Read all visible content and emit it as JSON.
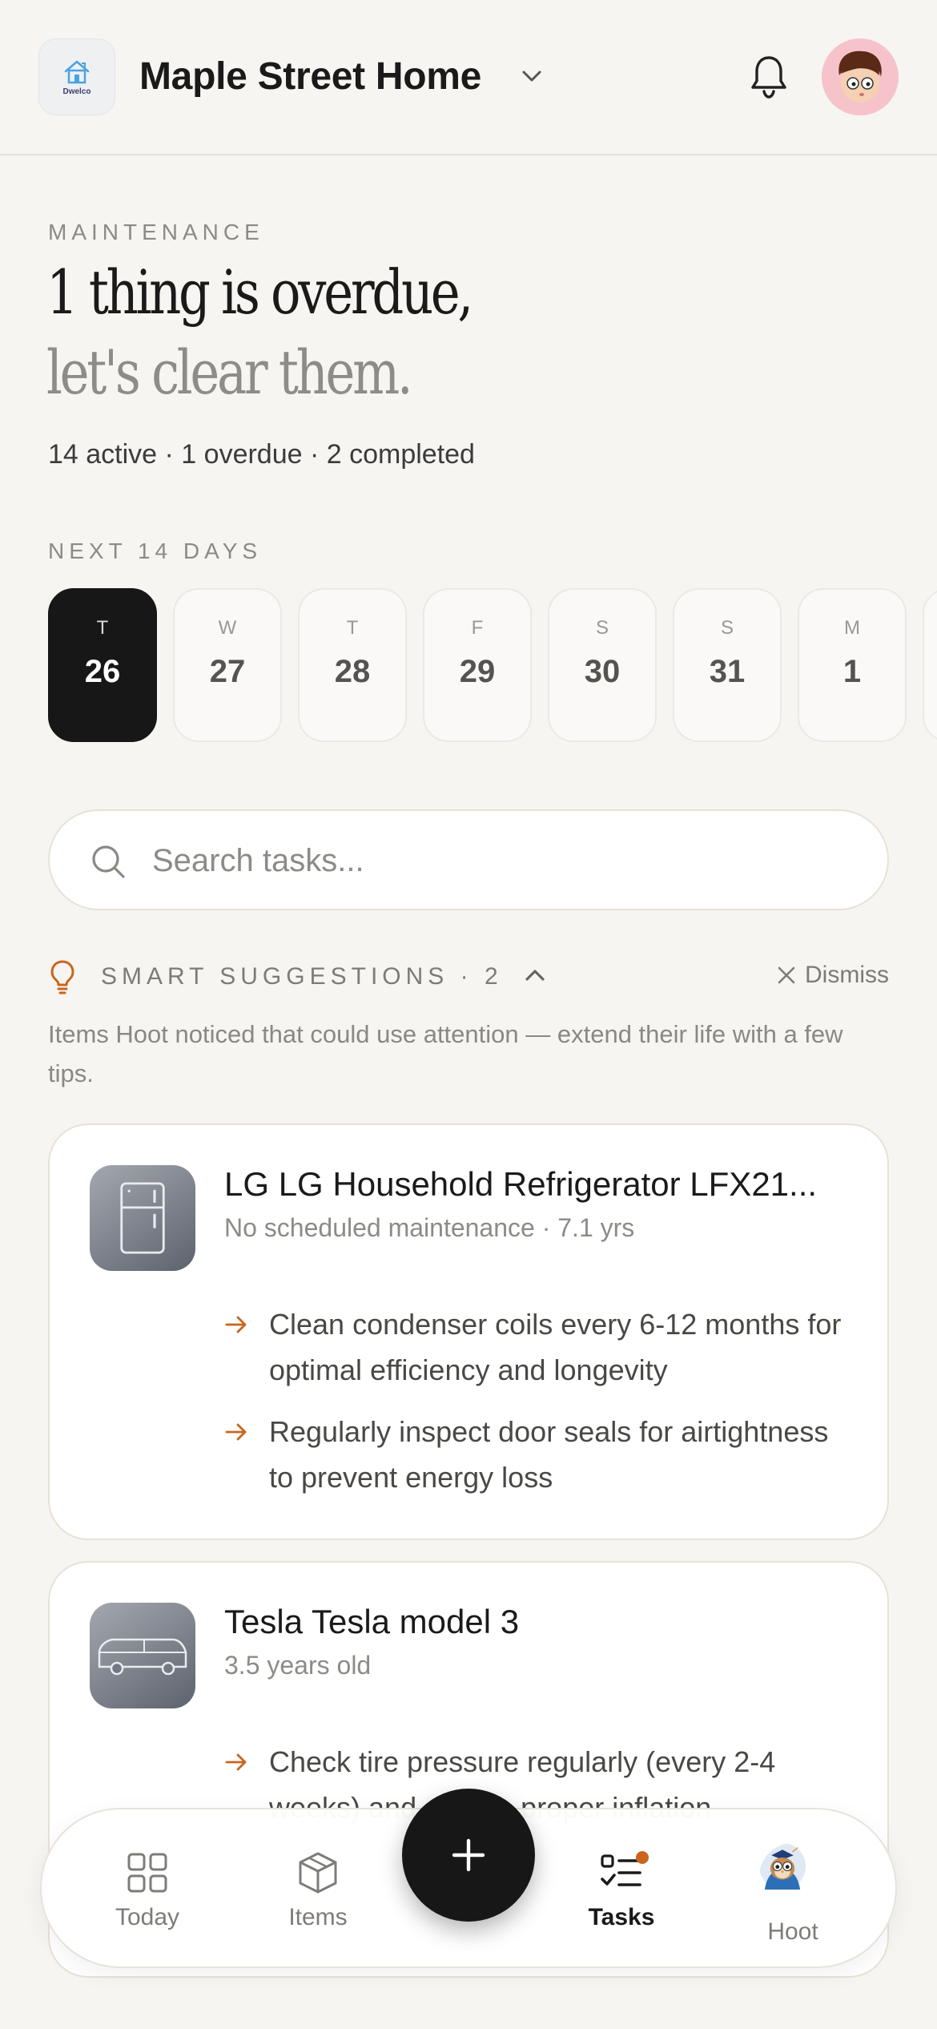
{
  "header": {
    "logo_text": "Dwelco",
    "home_name": "Maple Street Home"
  },
  "hero": {
    "eyebrow": "MAINTENANCE",
    "line1": "1 thing is overdue,",
    "line2": "let's clear them.",
    "stats": "14 active · 1 overdue · 2 completed"
  },
  "calendar": {
    "label": "NEXT 14 DAYS",
    "days": [
      {
        "dow": "T",
        "num": "26",
        "selected": true
      },
      {
        "dow": "W",
        "num": "27"
      },
      {
        "dow": "T",
        "num": "28"
      },
      {
        "dow": "F",
        "num": "29"
      },
      {
        "dow": "S",
        "num": "30"
      },
      {
        "dow": "S",
        "num": "31"
      },
      {
        "dow": "M",
        "num": "1"
      },
      {
        "dow": "",
        "num": ""
      }
    ]
  },
  "search": {
    "placeholder": "Search tasks..."
  },
  "suggestions": {
    "title": "SMART SUGGESTIONS · 2",
    "dismiss_label": "Dismiss",
    "description": "Items Hoot noticed that could use attention — extend their life with a few tips.",
    "cards": [
      {
        "icon": "refrigerator-icon",
        "title": "LG LG Household Refrigerator LFX21...",
        "subtitle": "No scheduled maintenance · 7.1 yrs",
        "tips": [
          "Clean condenser coils every 6-12 months for optimal efficiency and longevity",
          "Regularly inspect door seals for airtightness to prevent energy loss"
        ]
      },
      {
        "icon": "car-icon",
        "title": "Tesla Tesla model 3",
        "subtitle": "3.5 years old",
        "tips": [
          "Check tire pressure regularly (every 2-4 weeks) and ensure proper inflation"
        ]
      }
    ]
  },
  "nav": {
    "items": [
      {
        "label": "Today",
        "icon": "grid-icon"
      },
      {
        "label": "Items",
        "icon": "box-icon"
      },
      {
        "label": "Tasks",
        "icon": "checklist-icon",
        "active": true,
        "badge": true
      },
      {
        "label": "Hoot",
        "icon": "owl-avatar"
      }
    ],
    "fab_icon": "plus-icon"
  },
  "colors": {
    "background": "#f6f5f1",
    "accent": "#c9651e",
    "selected_day": "#171717"
  }
}
